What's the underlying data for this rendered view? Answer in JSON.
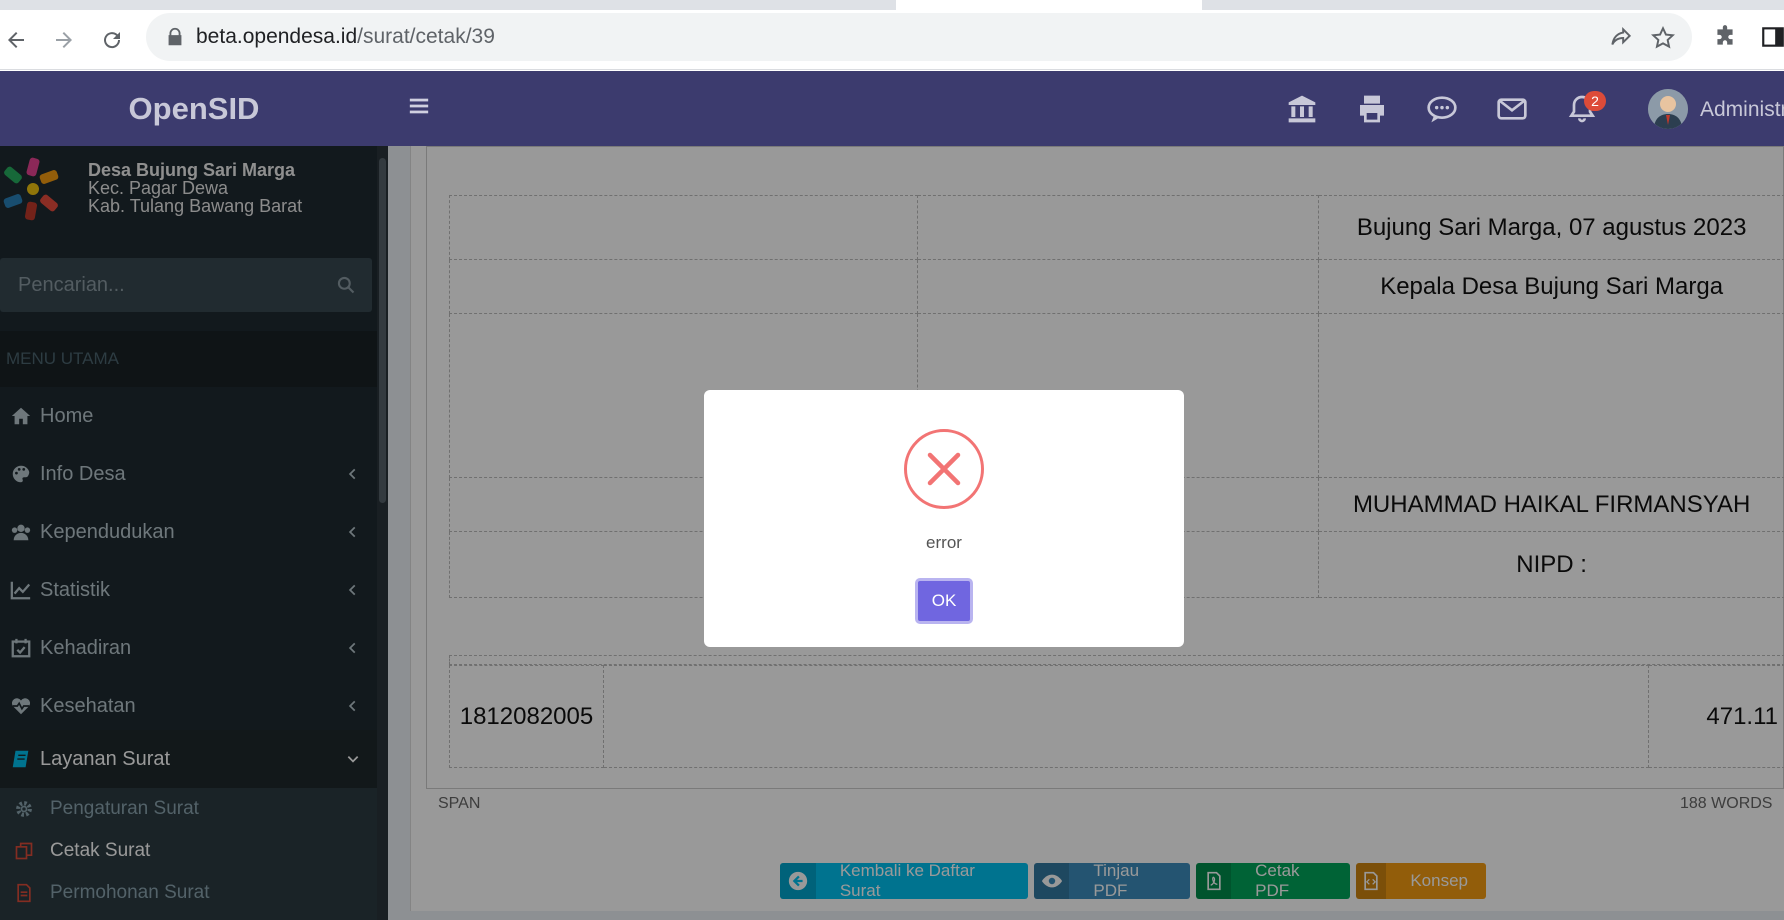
{
  "browser": {
    "url_host": "beta.opendesa.id",
    "url_path": "/surat/cetak/39"
  },
  "header": {
    "brand": "OpenSID",
    "notification_count": "2",
    "user_name": "Administrator"
  },
  "sidebar": {
    "village_name": "Desa Bujung Sari Marga",
    "district": "Kec. Pagar Dewa",
    "regency": "Kab. Tulang Bawang Barat",
    "search_placeholder": "Pencarian...",
    "menu_header": "MENU UTAMA",
    "items": [
      {
        "label": "Home",
        "icon": "home-icon"
      },
      {
        "label": "Info Desa",
        "icon": "palette-icon"
      },
      {
        "label": "Kependudukan",
        "icon": "users-icon"
      },
      {
        "label": "Statistik",
        "icon": "line-chart-icon"
      },
      {
        "label": "Kehadiran",
        "icon": "calendar-check-icon"
      },
      {
        "label": "Kesehatan",
        "icon": "heartbeat-icon"
      },
      {
        "label": "Layanan Surat",
        "icon": "book-icon"
      }
    ],
    "subitems": [
      {
        "label": "Pengaturan Surat",
        "icon": "gear-icon"
      },
      {
        "label": "Cetak Surat",
        "icon": "copy-icon"
      },
      {
        "label": "Permohonan Surat",
        "icon": "document-icon"
      }
    ]
  },
  "document": {
    "date_line": "Bujung Sari Marga, 07 agustus 2023",
    "signer_title": "Kepala Desa Bujung Sari Marga",
    "signer_name": "MUHAMMAD HAIKAL FIRMANSYAH",
    "nipd": "NIPD :",
    "footer_code": "1812082005",
    "footer_number": "471.11"
  },
  "editor_status": {
    "element": "SPAN",
    "word_count": "188 WORDS"
  },
  "actions": {
    "back": "Kembali ke Daftar Surat",
    "preview": "Tinjau PDF",
    "print": "Cetak PDF",
    "draft": "Konsep"
  },
  "modal": {
    "message": "error",
    "ok_label": "OK"
  },
  "colors": {
    "header_bg": "#3c3b6e",
    "sidebar_bg": "#1f2b31",
    "btn_back": "#00c0ef",
    "btn_preview": "#3c8dbc",
    "btn_print": "#00a65a",
    "btn_draft": "#f39c12",
    "ok_button": "#7066e0",
    "error_icon": "#f27474"
  }
}
